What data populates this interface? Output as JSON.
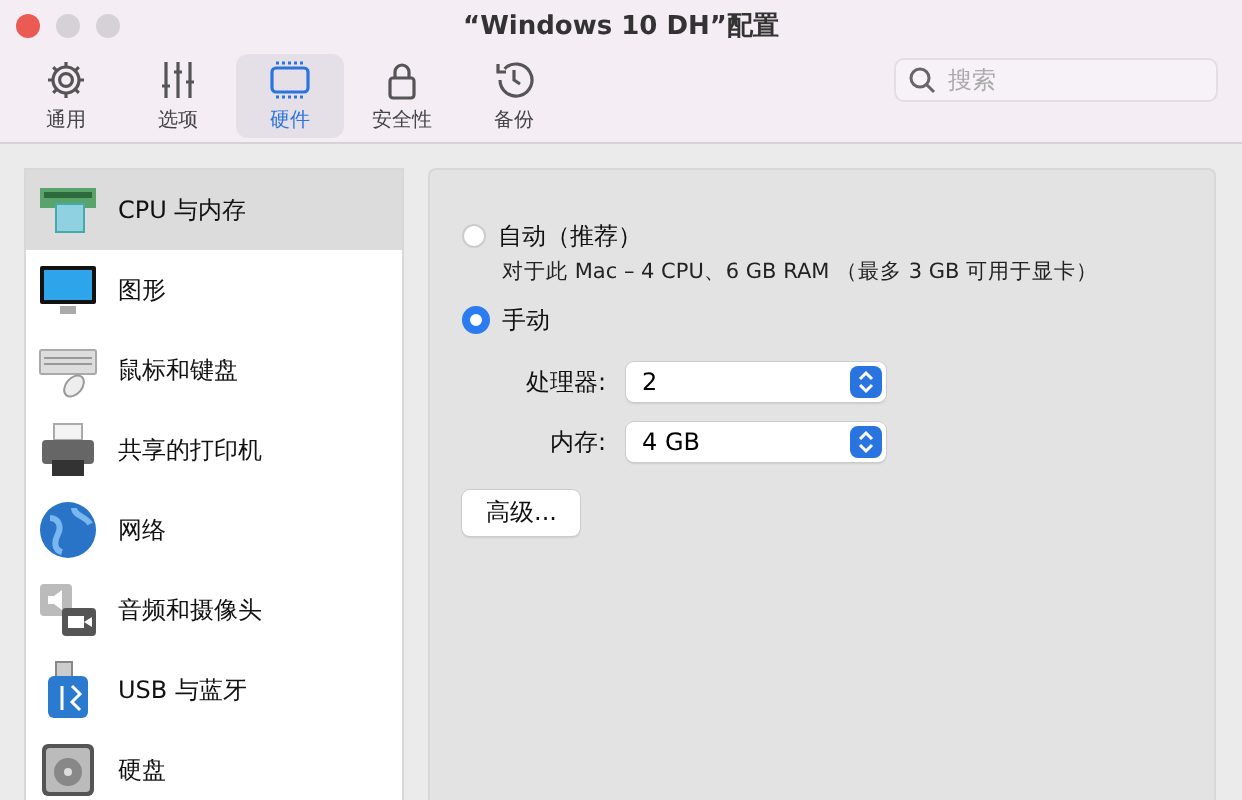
{
  "window": {
    "title": "“Windows 10 DH”配置"
  },
  "toolbar": [
    {
      "label": "通用",
      "selected": false
    },
    {
      "label": "选项",
      "selected": false
    },
    {
      "label": "硬件",
      "selected": true
    },
    {
      "label": "安全性",
      "selected": false
    },
    {
      "label": "备份",
      "selected": false
    }
  ],
  "search": {
    "placeholder": "搜索"
  },
  "sidebar": {
    "items": [
      {
        "label": "CPU 与内存",
        "selected": true
      },
      {
        "label": "图形",
        "selected": false
      },
      {
        "label": "鼠标和键盘",
        "selected": false
      },
      {
        "label": "共享的打印机",
        "selected": false
      },
      {
        "label": "网络",
        "selected": false
      },
      {
        "label": "音频和摄像头",
        "selected": false
      },
      {
        "label": "USB 与蓝牙",
        "selected": false
      },
      {
        "label": "硬盘",
        "selected": false
      }
    ]
  },
  "panel": {
    "modes": [
      {
        "label": "自动（推荐）",
        "selected": false,
        "note": "对于此 Mac – 4 CPU、6 GB RAM （最多 3 GB 可用于显卡）"
      },
      {
        "label": "手动",
        "selected": true
      }
    ],
    "selects": [
      {
        "label": "处理器:",
        "value": "2"
      },
      {
        "label": "内存:",
        "value": "4 GB"
      }
    ],
    "button": "高级..."
  }
}
